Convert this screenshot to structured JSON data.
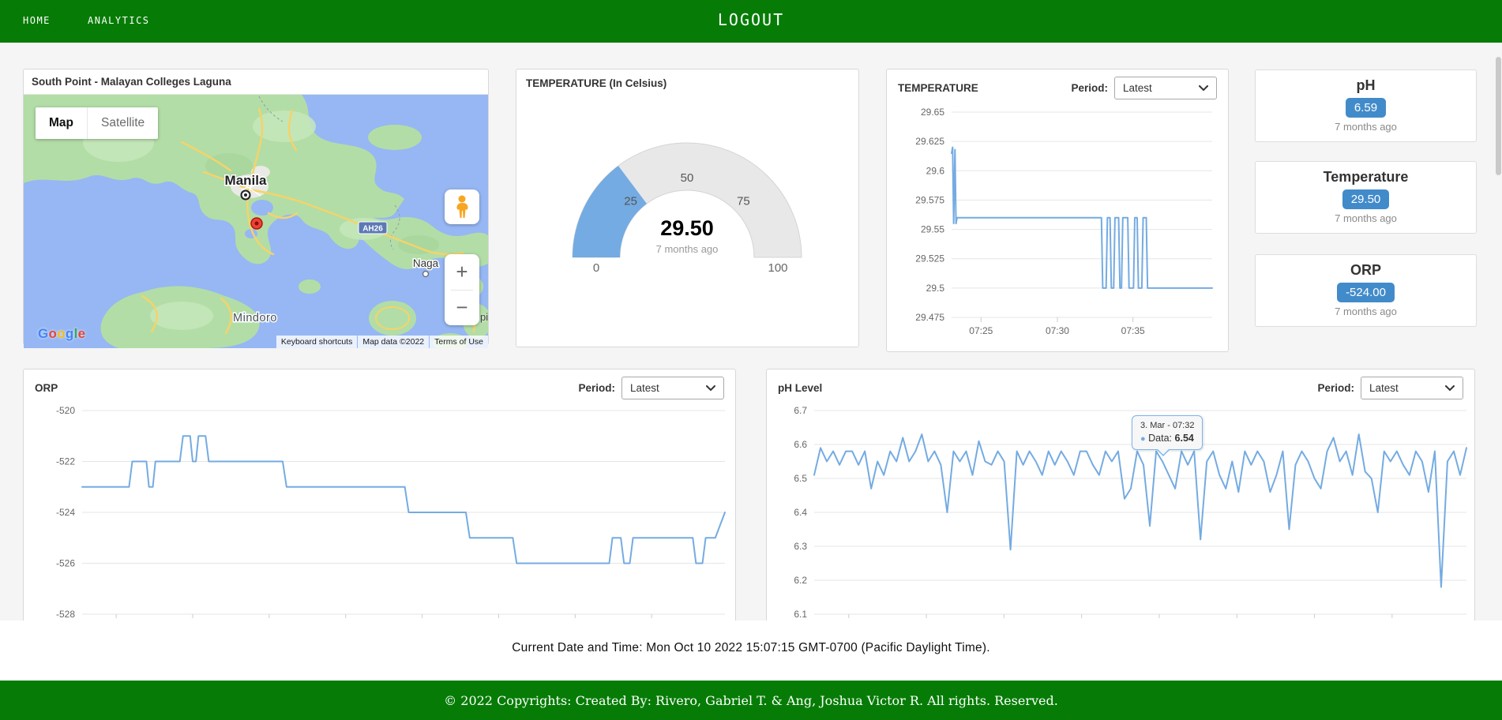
{
  "colors": {
    "green": "#067c06",
    "chart_blue": "#74abe2",
    "badge_blue": "#428bca",
    "grid": "#e6e6e6"
  },
  "nav": {
    "home": "HOME",
    "analytics": "ANALYTICS",
    "logout": "LOGOUT"
  },
  "map": {
    "title": "South Point - Malayan Colleges Laguna",
    "buttons": {
      "map": "Map",
      "satellite": "Satellite"
    },
    "labels": {
      "manila": "Manila",
      "naga": "Naga",
      "mindoro": "Mindoro",
      "highway": "AH26",
      "fragment": "pi"
    },
    "google": "Google",
    "attribution": {
      "shortcuts": "Keyboard shortcuts",
      "mapdata": "Map data ©2022",
      "terms": "Terms of Use"
    }
  },
  "gauge_panel": {
    "title": "TEMPERATURE (In Celsius)"
  },
  "temp_panel": {
    "title": "TEMPERATURE",
    "period_label": "Period:",
    "period_value": "Latest"
  },
  "orp_panel": {
    "title": "ORP",
    "period_label": "Period:",
    "period_value": "Latest"
  },
  "ph_panel": {
    "title": "pH Level",
    "period_label": "Period:",
    "period_value": "Latest",
    "tooltip": {
      "date": "3. Mar - 07:32",
      "dot": "●",
      "label": "Data:",
      "value": "6.54"
    }
  },
  "cards": [
    {
      "title": "pH",
      "value": "6.59",
      "ago": "7 months ago"
    },
    {
      "title": "Temperature",
      "value": "29.50",
      "ago": "7 months ago"
    },
    {
      "title": "ORP",
      "value": "-524.00",
      "ago": "7 months ago"
    }
  ],
  "footer": {
    "datetime": "Current Date and Time: Mon Oct 10 2022 15:07:15 GMT-0700 (Pacific Daylight Time).",
    "copyright": "© 2022 Copyrights: Created By: Rivero, Gabriel T. & Ang, Joshua Victor R. All rights. Reserved."
  },
  "chart_data": [
    {
      "type": "gauge",
      "title": "TEMPERATURE (In Celsius)",
      "value": 29.5,
      "value_label": "29.50",
      "subtitle": "7 months ago",
      "min": 0,
      "max": 100,
      "ticks": [
        0,
        25,
        50,
        75,
        100
      ],
      "band_color": "#74abe2",
      "track_color": "#e8e8e8"
    },
    {
      "type": "line",
      "title": "TEMPERATURE",
      "legend": "none",
      "grid": true,
      "ylim": [
        29.475,
        29.65
      ],
      "yticks": [
        29.475,
        29.5,
        29.525,
        29.55,
        29.575,
        29.6,
        29.625,
        29.65
      ],
      "xticks": [
        {
          "f": 0.113,
          "label": "07:25"
        },
        {
          "f": 0.406,
          "label": "07:30"
        },
        {
          "f": 0.696,
          "label": "07:35"
        }
      ],
      "color": "#74abe2",
      "plot": {
        "l": 78,
        "t": 12,
        "r": 408,
        "b": 272
      },
      "series_points": [
        [
          0.0,
          29.615
        ],
        [
          0.004,
          29.62
        ],
        [
          0.008,
          29.555
        ],
        [
          0.013,
          29.618
        ],
        [
          0.017,
          29.555
        ],
        [
          0.021,
          29.56
        ],
        [
          0.575,
          29.56
        ],
        [
          0.58,
          29.5
        ],
        [
          0.593,
          29.5
        ],
        [
          0.598,
          29.56
        ],
        [
          0.608,
          29.56
        ],
        [
          0.613,
          29.5
        ],
        [
          0.622,
          29.5
        ],
        [
          0.627,
          29.56
        ],
        [
          0.641,
          29.56
        ],
        [
          0.646,
          29.5
        ],
        [
          0.652,
          29.5
        ],
        [
          0.657,
          29.56
        ],
        [
          0.676,
          29.56
        ],
        [
          0.681,
          29.5
        ],
        [
          0.698,
          29.5
        ],
        [
          0.703,
          29.56
        ],
        [
          0.712,
          29.56
        ],
        [
          0.717,
          29.5
        ],
        [
          0.73,
          29.5
        ],
        [
          0.735,
          29.56
        ],
        [
          0.747,
          29.56
        ],
        [
          0.752,
          29.5
        ],
        [
          1.0,
          29.5
        ]
      ]
    },
    {
      "type": "line",
      "title": "ORP",
      "legend": "none",
      "grid": true,
      "ylim": [
        -528,
        -520
      ],
      "yticks": [
        -528,
        -526,
        -524,
        -522,
        -520
      ],
      "minor_ticks": [
        0.053,
        0.172,
        0.291,
        0.41,
        0.529,
        0.648,
        0.767,
        0.886
      ],
      "color": "#74abe2",
      "plot": {
        "l": 72,
        "t": 10,
        "r": 886,
        "b": 268
      },
      "series_points": [
        [
          0.0,
          -523
        ],
        [
          0.073,
          -523
        ],
        [
          0.078,
          -522
        ],
        [
          0.1,
          -522
        ],
        [
          0.104,
          -523
        ],
        [
          0.11,
          -523
        ],
        [
          0.114,
          -522
        ],
        [
          0.152,
          -522
        ],
        [
          0.157,
          -521
        ],
        [
          0.168,
          -521
        ],
        [
          0.172,
          -522
        ],
        [
          0.177,
          -522
        ],
        [
          0.181,
          -521
        ],
        [
          0.192,
          -521
        ],
        [
          0.197,
          -522
        ],
        [
          0.312,
          -522
        ],
        [
          0.318,
          -523
        ],
        [
          0.502,
          -523
        ],
        [
          0.508,
          -524
        ],
        [
          0.597,
          -524
        ],
        [
          0.603,
          -525
        ],
        [
          0.67,
          -525
        ],
        [
          0.676,
          -526
        ],
        [
          0.82,
          -526
        ],
        [
          0.825,
          -525
        ],
        [
          0.838,
          -525
        ],
        [
          0.843,
          -526
        ],
        [
          0.852,
          -526
        ],
        [
          0.857,
          -525
        ],
        [
          0.95,
          -525
        ],
        [
          0.955,
          -526
        ],
        [
          0.965,
          -526
        ],
        [
          0.97,
          -525
        ],
        [
          0.985,
          -525
        ],
        [
          1.0,
          -524
        ]
      ]
    },
    {
      "type": "line",
      "title": "pH Level",
      "legend": "none",
      "grid": true,
      "ylim": [
        6.1,
        6.7
      ],
      "yticks": [
        6.1,
        6.2,
        6.3,
        6.4,
        6.5,
        6.6,
        6.7
      ],
      "minor_ticks": [
        0.053,
        0.172,
        0.291,
        0.41,
        0.529,
        0.648,
        0.767,
        0.886
      ],
      "color": "#74abe2",
      "plot": {
        "l": 58,
        "t": 10,
        "r": 884,
        "b": 268
      },
      "series_values": [
        6.51,
        6.59,
        6.55,
        6.58,
        6.54,
        6.58,
        6.58,
        6.54,
        6.58,
        6.47,
        6.55,
        6.51,
        6.58,
        6.55,
        6.62,
        6.55,
        6.58,
        6.63,
        6.55,
        6.58,
        6.54,
        6.4,
        6.58,
        6.55,
        6.58,
        6.51,
        6.61,
        6.55,
        6.54,
        6.58,
        6.55,
        6.29,
        6.58,
        6.54,
        6.58,
        6.55,
        6.51,
        6.58,
        6.54,
        6.58,
        6.55,
        6.51,
        6.58,
        6.58,
        6.54,
        6.51,
        6.58,
        6.55,
        6.58,
        6.44,
        6.47,
        6.58,
        6.54,
        6.36,
        6.58,
        6.55,
        6.51,
        6.47,
        6.58,
        6.54,
        6.58,
        6.32,
        6.55,
        6.58,
        6.51,
        6.47,
        6.55,
        6.46,
        6.58,
        6.54,
        6.58,
        6.55,
        6.46,
        6.51,
        6.58,
        6.35,
        6.54,
        6.58,
        6.55,
        6.5,
        6.47,
        6.58,
        6.62,
        6.55,
        6.58,
        6.51,
        6.63,
        6.52,
        6.5,
        6.4,
        6.58,
        6.55,
        6.58,
        6.54,
        6.51,
        6.58,
        6.55,
        6.46,
        6.58,
        6.18,
        6.55,
        6.58,
        6.51,
        6.59
      ]
    }
  ]
}
